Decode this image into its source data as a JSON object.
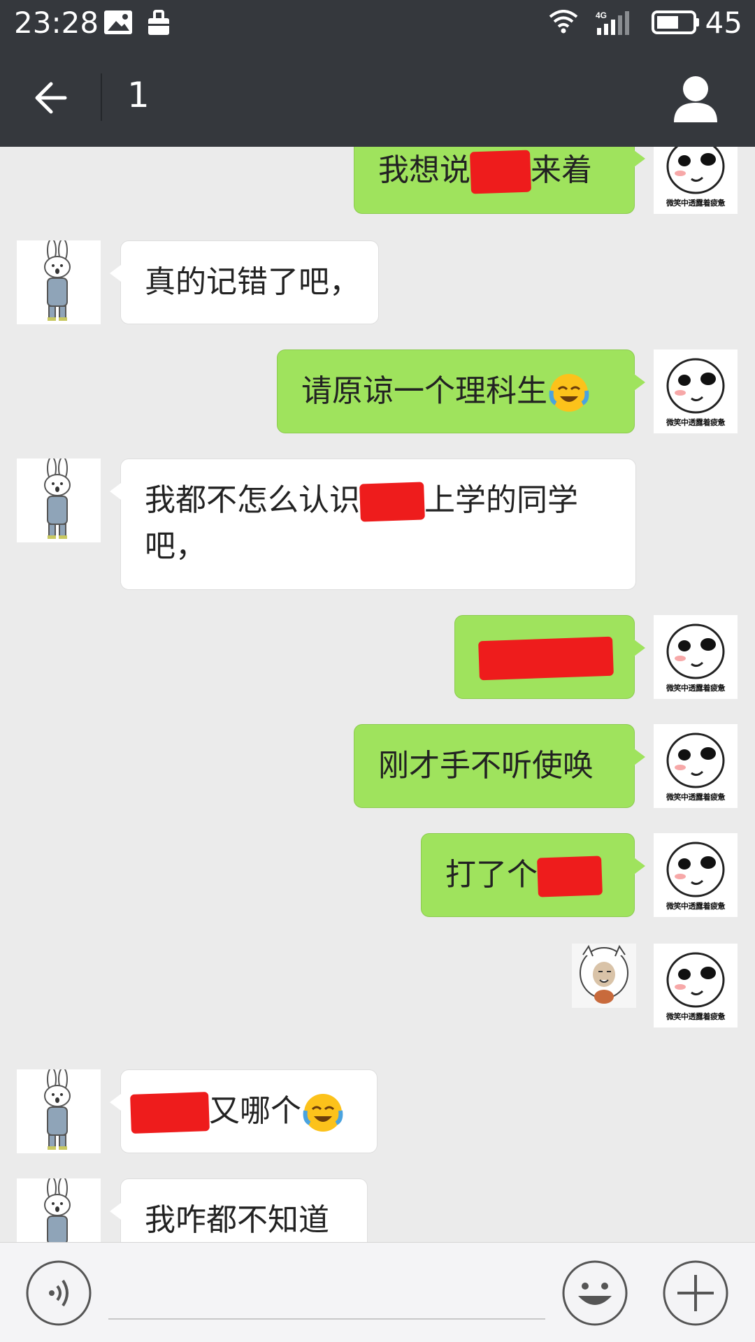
{
  "status_bar": {
    "time": "23:28",
    "network": "4G",
    "battery": "45"
  },
  "header": {
    "title": "1"
  },
  "avatar_caption": "微笑中透露着疲惫",
  "messages": [
    {
      "side": "sent",
      "text_before": "我想说",
      "text_after": "来着"
    },
    {
      "side": "received",
      "text": "真的记错了吧，"
    },
    {
      "side": "sent",
      "text": "请原谅一个理科生",
      "emoji": "face-with-tears-of-joy"
    },
    {
      "side": "received",
      "text_before": "我都不怎么认识",
      "text_after": "上学的同学吧，"
    },
    {
      "side": "sent",
      "redacted": true
    },
    {
      "side": "sent",
      "text": "刚才手不听使唤"
    },
    {
      "side": "sent",
      "text_before": "打了个"
    },
    {
      "side": "sent",
      "sticker": "meme-face-sticker"
    },
    {
      "side": "received",
      "text_after": "又哪个",
      "emoji": "face-with-tears-of-joy"
    },
    {
      "side": "received",
      "text": "我咋都不知道"
    }
  ],
  "input": {
    "placeholder": "",
    "value": ""
  },
  "colors": {
    "header_bg": "#35383d",
    "sent_bubble": "#9fe35d",
    "received_bubble": "#ffffff",
    "chat_bg": "#ebebeb",
    "redaction": "#ee1c1c"
  }
}
